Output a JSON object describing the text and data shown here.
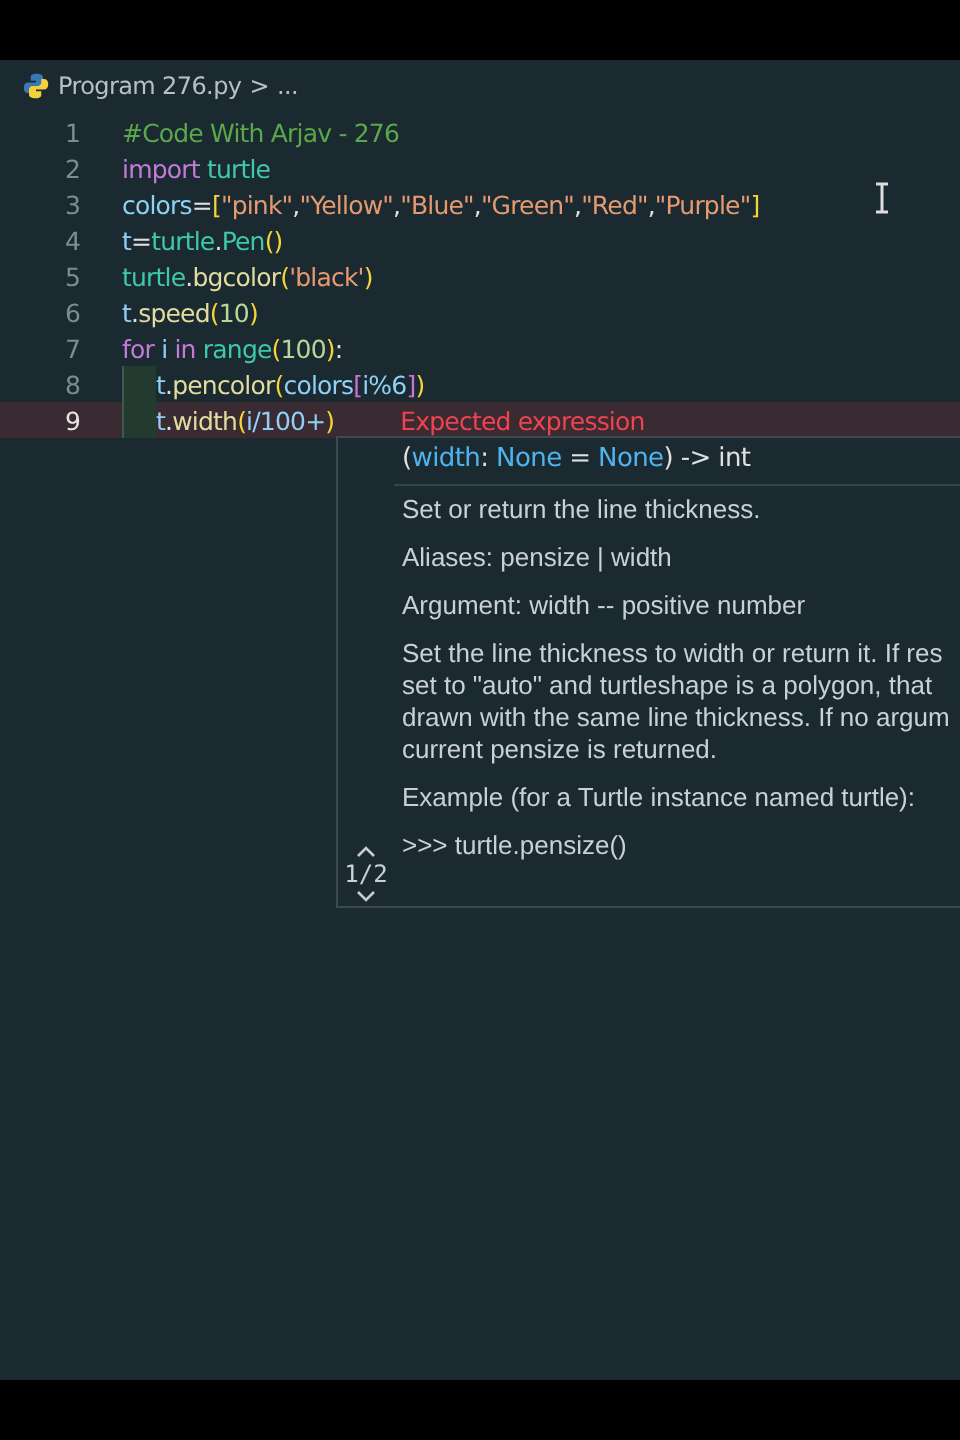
{
  "breadcrumb": {
    "file": "Program 276.py",
    "separator": ">",
    "rest": "..."
  },
  "code_lines": [
    {
      "number": "1",
      "indented": false,
      "current": false,
      "tokens": [
        {
          "t": "#Code With Arjav - 276",
          "color": "#5aa84a"
        }
      ]
    },
    {
      "number": "2",
      "indented": false,
      "current": false,
      "tokens": [
        {
          "t": "import",
          "color": "#c47ad9"
        },
        {
          "t": " turtle",
          "color": "#3ec9a8"
        }
      ]
    },
    {
      "number": "3",
      "indented": false,
      "current": false,
      "tokens": [
        {
          "t": "colors",
          "color": "#8fd0f5"
        },
        {
          "t": "=",
          "color": "#e0e0e0"
        },
        {
          "t": "[",
          "color": "#f5d33a"
        },
        {
          "t": "\"pink\"",
          "color": "#e69a70"
        },
        {
          "t": ",",
          "color": "#e0e0e0"
        },
        {
          "t": "\"Yellow\"",
          "color": "#e69a70"
        },
        {
          "t": ",",
          "color": "#e0e0e0"
        },
        {
          "t": "\"Blue\"",
          "color": "#e69a70"
        },
        {
          "t": ",",
          "color": "#e0e0e0"
        },
        {
          "t": "\"Green\"",
          "color": "#e69a70"
        },
        {
          "t": ",",
          "color": "#e0e0e0"
        },
        {
          "t": "\"Red\"",
          "color": "#e69a70"
        },
        {
          "t": ",",
          "color": "#e0e0e0"
        },
        {
          "t": "\"Purple\"",
          "color": "#e69a70"
        },
        {
          "t": "]",
          "color": "#f5d33a"
        }
      ]
    },
    {
      "number": "4",
      "indented": false,
      "current": false,
      "tokens": [
        {
          "t": "t",
          "color": "#8fd0f5"
        },
        {
          "t": "=",
          "color": "#e0e0e0"
        },
        {
          "t": "turtle",
          "color": "#3ec9a8"
        },
        {
          "t": ".",
          "color": "#e0e0e0"
        },
        {
          "t": "Pen",
          "color": "#3ec9a8"
        },
        {
          "t": "()",
          "color": "#f5d33a"
        }
      ]
    },
    {
      "number": "5",
      "indented": false,
      "current": false,
      "tokens": [
        {
          "t": "turtle",
          "color": "#3ec9a8"
        },
        {
          "t": ".",
          "color": "#e0e0e0"
        },
        {
          "t": "bgcolor",
          "color": "#e2dca0"
        },
        {
          "t": "(",
          "color": "#f5d33a"
        },
        {
          "t": "'black'",
          "color": "#e69a70"
        },
        {
          "t": ")",
          "color": "#f5d33a"
        }
      ]
    },
    {
      "number": "6",
      "indented": false,
      "current": false,
      "tokens": [
        {
          "t": "t",
          "color": "#8fd0f5"
        },
        {
          "t": ".",
          "color": "#e0e0e0"
        },
        {
          "t": "speed",
          "color": "#e2dca0"
        },
        {
          "t": "(",
          "color": "#f5d33a"
        },
        {
          "t": "10",
          "color": "#b6d99a"
        },
        {
          "t": ")",
          "color": "#f5d33a"
        }
      ]
    },
    {
      "number": "7",
      "indented": false,
      "current": false,
      "tokens": [
        {
          "t": "for",
          "color": "#c47ad9"
        },
        {
          "t": " i ",
          "color": "#8fd0f5"
        },
        {
          "t": "in",
          "color": "#c47ad9"
        },
        {
          "t": " range",
          "color": "#3ec9a8"
        },
        {
          "t": "(",
          "color": "#f5d33a"
        },
        {
          "t": "100",
          "color": "#b6d99a"
        },
        {
          "t": ")",
          "color": "#f5d33a"
        },
        {
          "t": ":",
          "color": "#e0e0e0"
        }
      ]
    },
    {
      "number": "8",
      "indented": true,
      "current": false,
      "tokens": [
        {
          "t": "t",
          "color": "#8fd0f5"
        },
        {
          "t": ".",
          "color": "#e0e0e0"
        },
        {
          "t": "pencolor",
          "color": "#e2dca0"
        },
        {
          "t": "(",
          "color": "#f5d33a"
        },
        {
          "t": "colors",
          "color": "#8fd0f5"
        },
        {
          "t": "[",
          "color": "#d070d6"
        },
        {
          "t": "i%6",
          "color": "#8fd0f5"
        },
        {
          "t": "]",
          "color": "#d070d6"
        },
        {
          "t": ")",
          "color": "#f5d33a"
        }
      ]
    },
    {
      "number": "9",
      "indented": true,
      "current": true,
      "tokens": [
        {
          "t": "t",
          "color": "#8fd0f5"
        },
        {
          "t": ".",
          "color": "#e0e0e0"
        },
        {
          "t": "width",
          "color": "#e2dca0"
        },
        {
          "t": "(",
          "color": "#f5d33a"
        },
        {
          "t": "i/100+",
          "color": "#8fd0f5"
        },
        {
          "t": ")",
          "color": "#f5d33a"
        }
      ],
      "error": "Expected expression"
    }
  ],
  "hover": {
    "signature": [
      {
        "t": "(",
        "color": "#e0e0e0"
      },
      {
        "t": "width",
        "color": "#4fb3f0"
      },
      {
        "t": ": ",
        "color": "#e0e0e0"
      },
      {
        "t": "None",
        "color": "#4fb3f0"
      },
      {
        "t": " = ",
        "color": "#e0e0e0"
      },
      {
        "t": "None",
        "color": "#4fb3f0"
      },
      {
        "t": ") -> int",
        "color": "#e0e0e0"
      }
    ],
    "paragraphs": [
      [
        "Set or return the line thickness."
      ],
      [
        "Aliases: pensize | width"
      ],
      [
        "Argument: width -- positive number"
      ],
      [
        "Set the line thickness to width or return it. If res",
        "set to \"auto\" and turtleshape is a polygon, that",
        "drawn with the same line thickness. If no argum",
        "current pensize is returned."
      ],
      [
        "Example (for a Turtle instance named turtle):"
      ]
    ],
    "example": ">>> turtle.pensize()",
    "counter": "1/2"
  }
}
